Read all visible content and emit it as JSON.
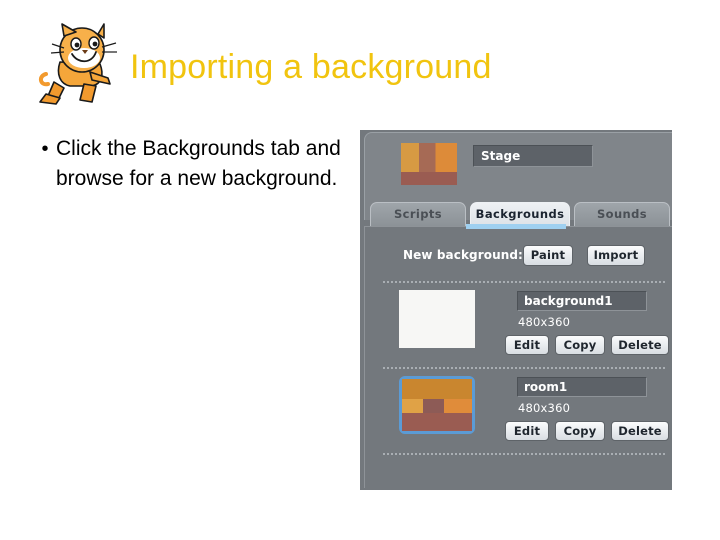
{
  "slide": {
    "title": "Importing a background",
    "title_color": "#f1c40f",
    "logo_name": "scratch-cat-logo",
    "bullets": [
      {
        "marker": "•",
        "text": "Click the Backgrounds tab and browse for a new background."
      }
    ]
  },
  "scratch_panel": {
    "sprite": {
      "name_value": "Stage",
      "thumbnail_name": "stage-thumbnail"
    },
    "tabs": [
      {
        "label": "Scripts",
        "active": false
      },
      {
        "label": "Backgrounds",
        "active": true
      },
      {
        "label": "Sounds",
        "active": false
      }
    ],
    "new_background": {
      "label": "New background:",
      "paint_label": "Paint",
      "import_label": "Import"
    },
    "row_actions": {
      "edit_label": "Edit",
      "copy_label": "Copy",
      "delete_label": "Delete"
    },
    "backgrounds": [
      {
        "name": "background1",
        "dimensions": "480x360",
        "selected": false,
        "thumbnail_kind": "blank-white"
      },
      {
        "name": "room1",
        "dimensions": "480x360",
        "selected": true,
        "thumbnail_kind": "room-scene"
      }
    ],
    "colors": {
      "panel_bg": "#73787d",
      "sprite_pane_bg": "#80858a",
      "field_bg": "#5d6268",
      "selection": "#5b9bd5",
      "active_tab_underline": "#9fd0f0"
    }
  }
}
